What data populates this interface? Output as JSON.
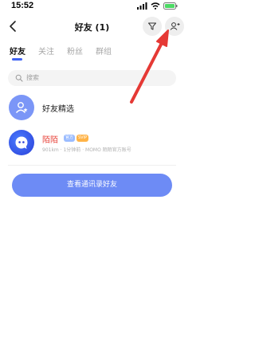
{
  "status_bar": {
    "time": "15:52"
  },
  "nav": {
    "title": "好友 (1)"
  },
  "tabs": [
    {
      "label": "好友",
      "active": true
    },
    {
      "label": "关注",
      "active": false
    },
    {
      "label": "粉丝",
      "active": false
    },
    {
      "label": "群组",
      "active": false
    }
  ],
  "search": {
    "placeholder": "搜索"
  },
  "featured": {
    "label": "好友精选"
  },
  "friend": {
    "name": "陌陌",
    "badge_official": "官方",
    "badge_svip": "SVIP",
    "meta": "901km · 1分钟前 · MOMO 陌陌官方账号"
  },
  "contacts_button": {
    "label": "查看通讯录好友"
  },
  "colors": {
    "accent": "#3f63f4",
    "button": "#6d8bf5",
    "arrow": "#e53935"
  },
  "icons": [
    "back-icon",
    "filter-icon",
    "add-friend-icon",
    "search-icon",
    "featured-user-icon",
    "momo-logo-icon"
  ]
}
